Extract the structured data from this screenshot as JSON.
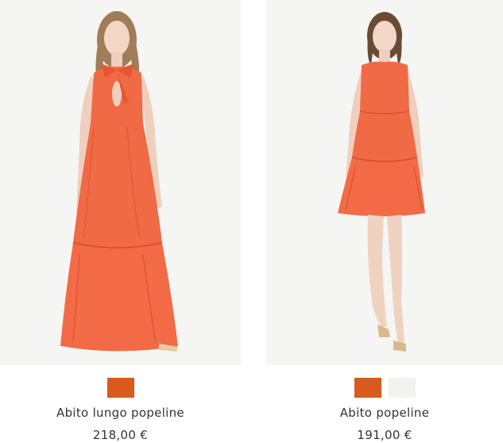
{
  "products": [
    {
      "name": "Abito lungo popeline",
      "price": "218,00 €",
      "swatches": [
        "#d95a1a"
      ]
    },
    {
      "name": "Abito popeline",
      "price": "191,00 €",
      "swatches": [
        "#d95a1a",
        "#f3f2ed"
      ]
    }
  ],
  "colors": {
    "background": "#ffffff",
    "photo_background": "#f5f5f3",
    "dress": "#f06a45",
    "dress_shadow": "#d9532f",
    "skin": "#f2d5c4",
    "hair": "#8a6a4a",
    "text": "#333333"
  }
}
